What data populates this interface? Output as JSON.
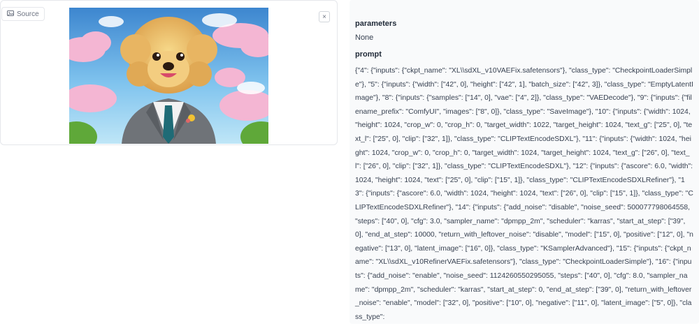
{
  "source": {
    "chip_label": "Source",
    "chip_icon": "image-icon",
    "close_icon": "close-icon",
    "close_label": "×",
    "image_alt": "Poodle in a suit"
  },
  "parameters": {
    "title": "parameters",
    "value": "None"
  },
  "prompt": {
    "title": "prompt",
    "text": "{\"4\": {\"inputs\": {\"ckpt_name\": \"XL\\\\sdXL_v10VAEFix.safetensors\"}, \"class_type\": \"CheckpointLoaderSimple\"}, \"5\": {\"inputs\": {\"width\": [\"42\", 0], \"height\": [\"42\", 1], \"batch_size\": [\"42\", 3]}, \"class_type\": \"EmptyLatentImage\"}, \"8\": {\"inputs\": {\"samples\": [\"14\", 0], \"vae\": [\"4\", 2]}, \"class_type\": \"VAEDecode\"}, \"9\": {\"inputs\": {\"filename_prefix\": \"ComfyUI\", \"images\": [\"8\", 0]}, \"class_type\": \"SaveImage\"}, \"10\": {\"inputs\": {\"width\": 1024, \"height\": 1024, \"crop_w\": 0, \"crop_h\": 0, \"target_width\": 1022, \"target_height\": 1024, \"text_g\": [\"25\", 0], \"text_l\": [\"25\", 0], \"clip\": [\"32\", 1]}, \"class_type\": \"CLIPTextEncodeSDXL\"}, \"11\": {\"inputs\": {\"width\": 1024, \"height\": 1024, \"crop_w\": 0, \"crop_h\": 0, \"target_width\": 1024, \"target_height\": 1024, \"text_g\": [\"26\", 0], \"text_l\": [\"26\", 0], \"clip\": [\"32\", 1]}, \"class_type\": \"CLIPTextEncodeSDXL\"}, \"12\": {\"inputs\": {\"ascore\": 6.0, \"width\": 1024, \"height\": 1024, \"text\": [\"25\", 0], \"clip\": [\"15\", 1]}, \"class_type\": \"CLIPTextEncodeSDXLRefiner\"}, \"13\": {\"inputs\": {\"ascore\": 6.0, \"width\": 1024, \"height\": 1024, \"text\": [\"26\", 0], \"clip\": [\"15\", 1]}, \"class_type\": \"CLIPTextEncodeSDXLRefiner\"}, \"14\": {\"inputs\": {\"add_noise\": \"disable\", \"noise_seed\": 500077798064558, \"steps\": [\"40\", 0], \"cfg\": 3.0, \"sampler_name\": \"dpmpp_2m\", \"scheduler\": \"karras\", \"start_at_step\": [\"39\", 0], \"end_at_step\": 10000, \"return_with_leftover_noise\": \"disable\", \"model\": [\"15\", 0], \"positive\": [\"12\", 0], \"negative\": [\"13\", 0], \"latent_image\": [\"16\", 0]}, \"class_type\": \"KSamplerAdvanced\"}, \"15\": {\"inputs\": {\"ckpt_name\": \"XL\\\\sdXL_v10RefinerVAEFix.safetensors\"}, \"class_type\": \"CheckpointLoaderSimple\"}, \"16\": {\"inputs\": {\"add_noise\": \"enable\", \"noise_seed\": 1124260550295055, \"steps\": [\"40\", 0], \"cfg\": 8.0, \"sampler_name\": \"dpmpp_2m\", \"scheduler\": \"karras\", \"start_at_step\": 0, \"end_at_step\": [\"39\", 0], \"return_with_leftover_noise\": \"enable\", \"model\": [\"32\", 0], \"positive\": [\"10\", 0], \"negative\": [\"11\", 0], \"latent_image\": [\"5\", 0]}, \"class_type\":"
  }
}
